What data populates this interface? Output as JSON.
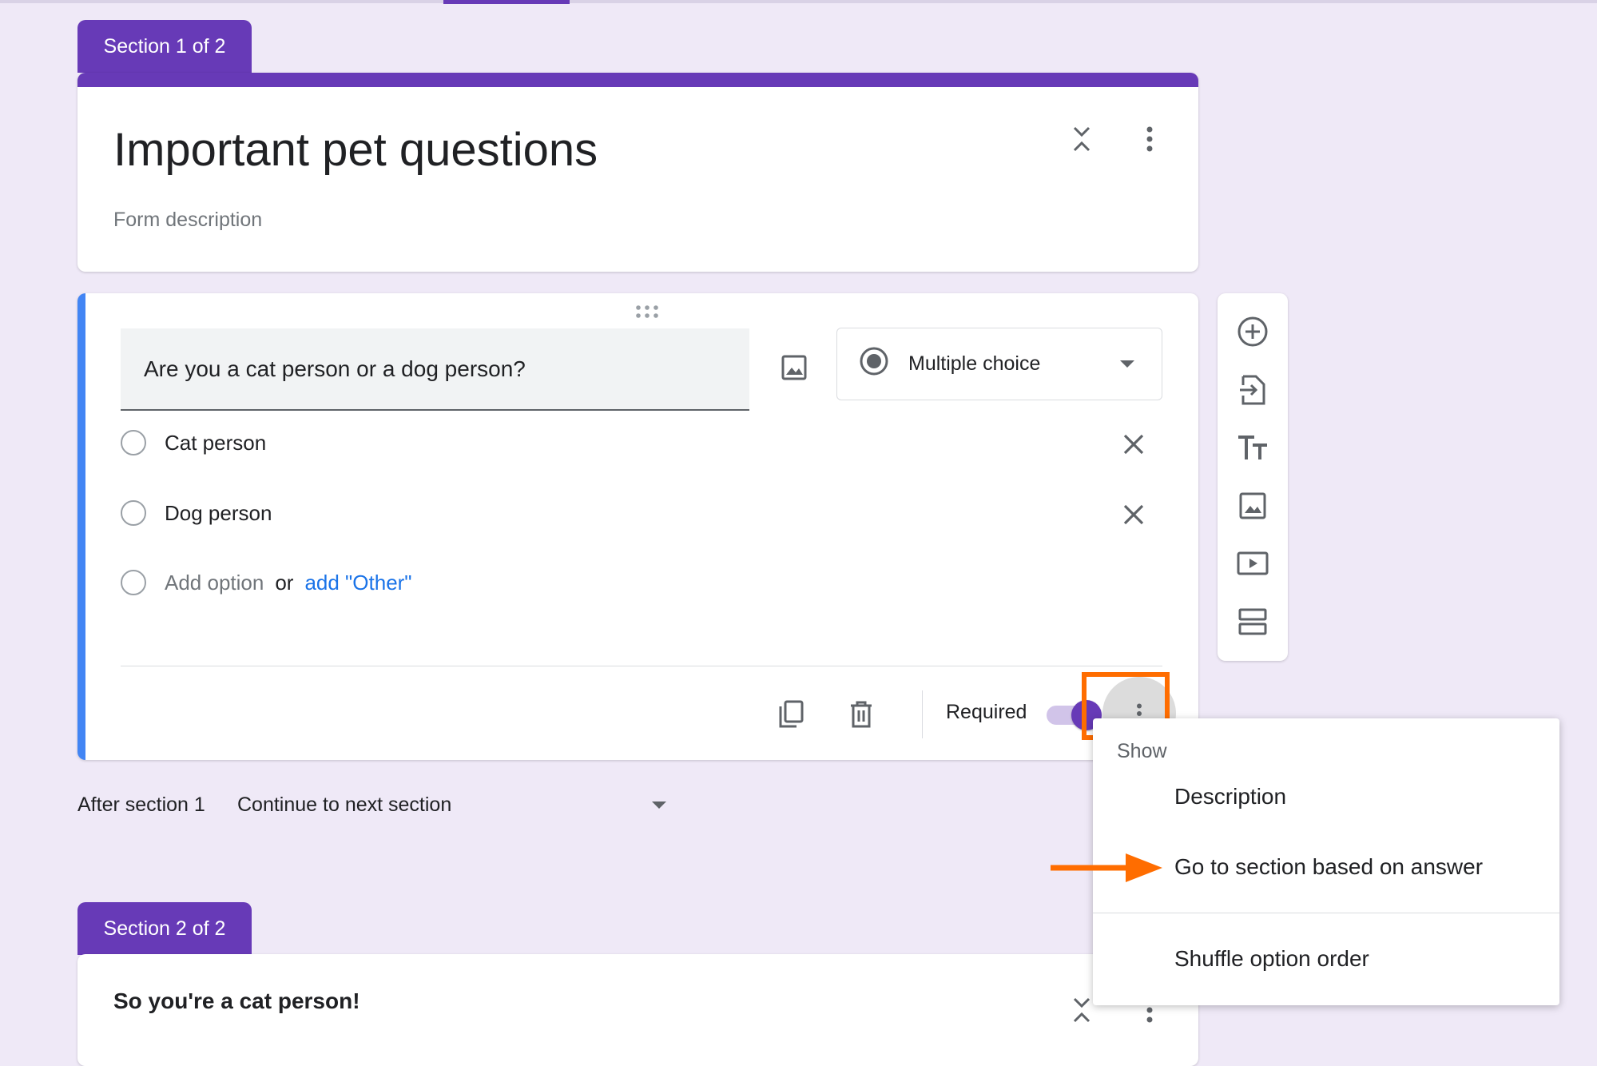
{
  "sections": [
    {
      "tab_label": "Section 1 of 2",
      "title": "Important pet questions",
      "description_placeholder": "Form description"
    },
    {
      "tab_label": "Section 2 of 2",
      "title": "So you're a cat person!"
    }
  ],
  "question": {
    "text": "Are you a cat person or a dog person?",
    "type_label": "Multiple choice",
    "options": [
      "Cat person",
      "Dog person"
    ],
    "add_option_label": "Add option",
    "or_label": "or",
    "add_other_label": "add \"Other\"",
    "required_label": "Required",
    "required_on": true
  },
  "after_section": {
    "label": "After section 1",
    "value": "Continue to next section"
  },
  "menu": {
    "header": "Show",
    "items": [
      "Description",
      "Go to section based on answer",
      "Shuffle option order"
    ]
  },
  "toolbar": {
    "icons": [
      "add-question-icon",
      "import-questions-icon",
      "add-title-icon",
      "add-image-icon",
      "add-video-icon",
      "add-section-icon"
    ]
  },
  "colors": {
    "accent": "#673ab7",
    "focus_border": "#4285f4",
    "link": "#1a73e8",
    "highlight": "#ff6d00",
    "background": "#efe9f7"
  }
}
